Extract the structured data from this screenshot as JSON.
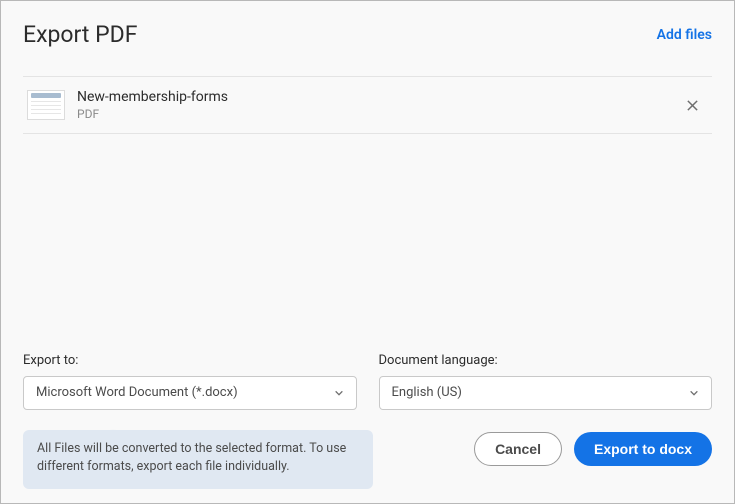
{
  "header": {
    "title": "Export PDF",
    "add_files": "Add files"
  },
  "files": [
    {
      "name": "New-membership-forms",
      "type": "PDF"
    }
  ],
  "export_to": {
    "label": "Export to:",
    "selected": "Microsoft Word Document (*.docx)"
  },
  "document_language": {
    "label": "Document language:",
    "selected": "English (US)"
  },
  "hint": "All Files will be converted to the selected format. To use different formats, export each file individually.",
  "actions": {
    "cancel": "Cancel",
    "export": "Export to docx"
  }
}
